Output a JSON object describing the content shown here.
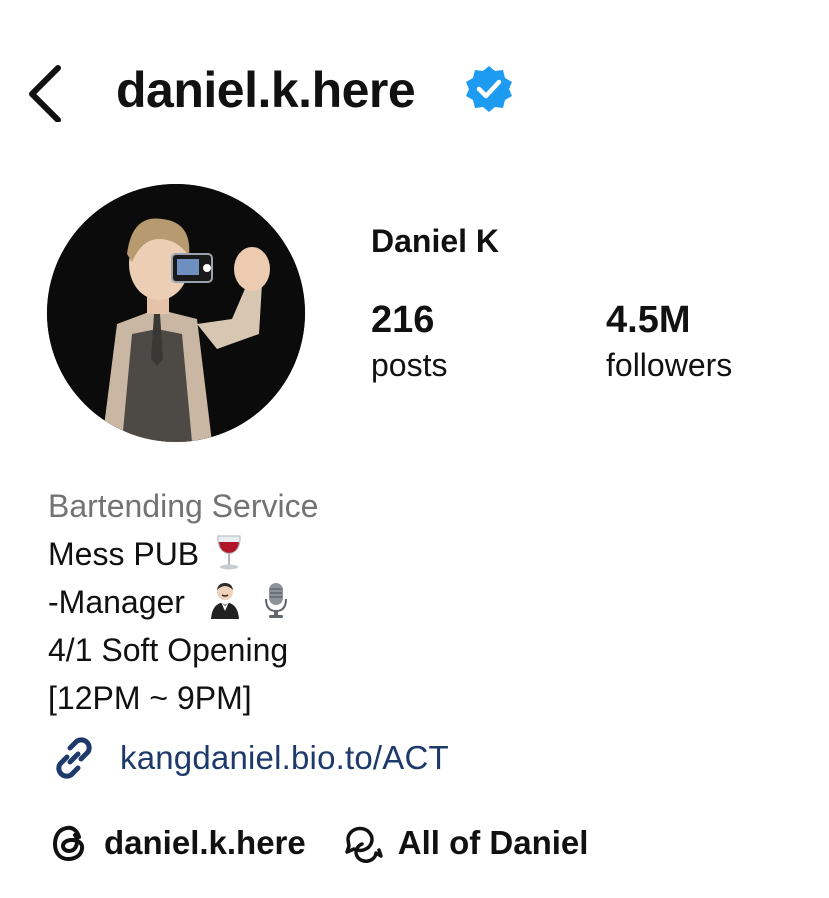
{
  "header": {
    "username": "daniel.k.here",
    "verified": true
  },
  "profile": {
    "display_name": "Daniel K",
    "stats": [
      {
        "value": "216",
        "label": "posts"
      },
      {
        "value": "4.5M",
        "label": "followers"
      }
    ]
  },
  "bio": {
    "category": "Bartending Service",
    "lines": [
      "Mess PUB",
      "-Manager",
      "4/1 Soft Opening",
      "[12PM ~ 9PM]"
    ]
  },
  "link": {
    "text": "kangdaniel.bio.to/ACT"
  },
  "bottom": {
    "threads_handle": "daniel.k.here",
    "channel_name": "All of Daniel"
  },
  "colors": {
    "verified_blue": "#1d9bf0",
    "link_blue": "#1e3a6b",
    "category_gray": "#737373"
  },
  "icons": {
    "back": "chevron-left-icon",
    "verified": "verified-badge-icon",
    "link": "link-chain-icon",
    "threads": "threads-logo-icon",
    "channel": "chat-bubbles-icon"
  }
}
